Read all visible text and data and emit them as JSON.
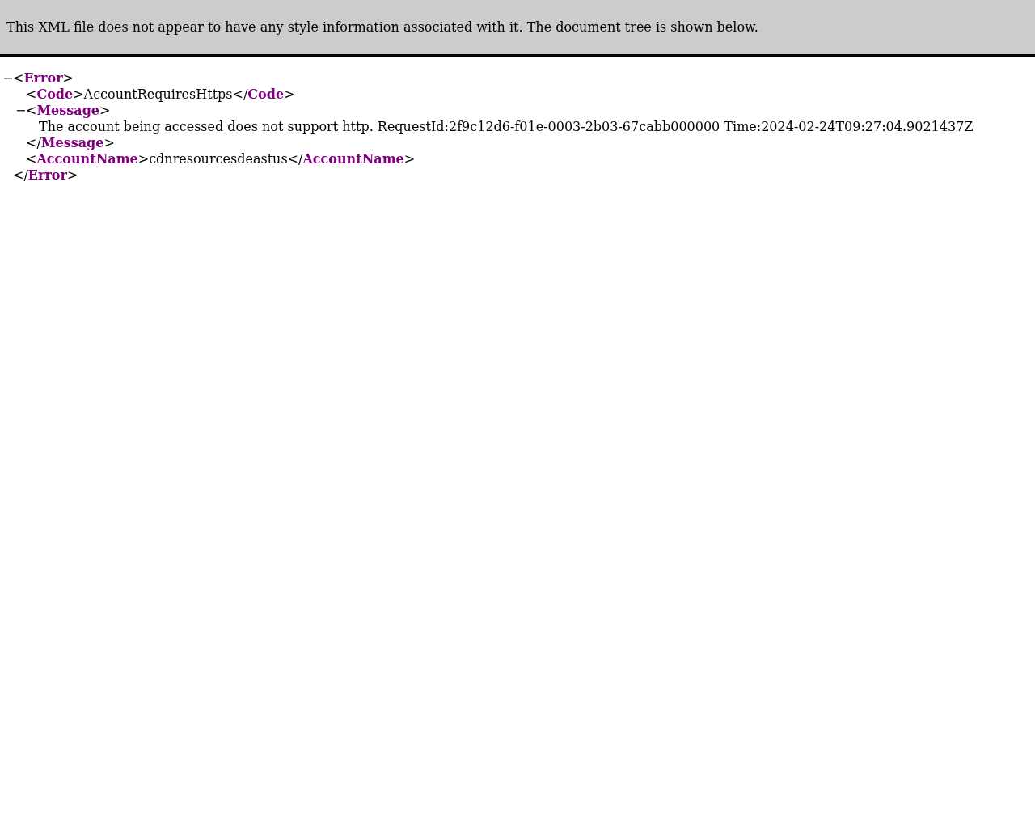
{
  "banner": {
    "message": "This XML file does not appear to have any style information associated with it. The document tree is shown below."
  },
  "brackets": {
    "open": "<",
    "close": "</",
    "end": ">"
  },
  "tree": {
    "kind": "collapsible",
    "tag": "Error",
    "closing_tag": "Error",
    "toggle": "−",
    "children": [
      {
        "kind": "inline",
        "tag": "Code",
        "text": "AccountRequiresHttps",
        "closing_tag": "Code"
      },
      {
        "kind": "collapsible",
        "tag": "Message",
        "closing_tag": "Message",
        "toggle": "−",
        "children": [
          {
            "kind": "text",
            "text": "The account being accessed does not support http. RequestId:2f9c12d6-f01e-0003-2b03-67cabb000000 Time:2024-02-24T09:27:04.9021437Z"
          }
        ]
      },
      {
        "kind": "inline",
        "tag": "AccountName",
        "text": "cdnresourcesdeastus",
        "closing_tag": "AccountName"
      }
    ]
  }
}
